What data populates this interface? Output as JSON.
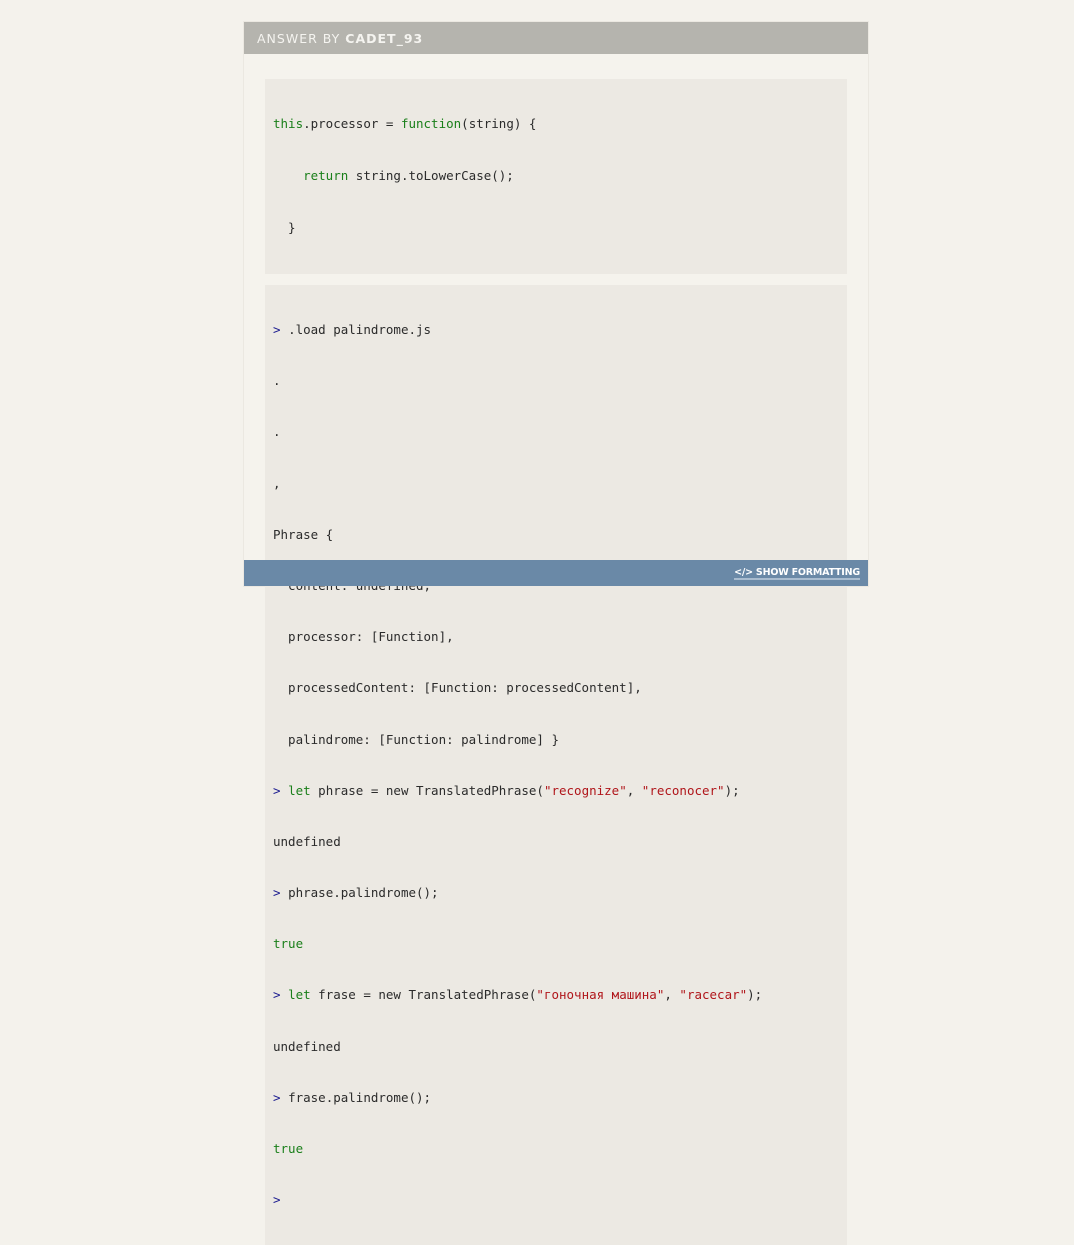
{
  "header": {
    "label": "ANSWER BY",
    "author": "CADET_93"
  },
  "code_block": {
    "lines": [
      {
        "kw1": "this",
        "t1": ".processor = ",
        "kw2": "function",
        "t2": "(string) {"
      },
      {
        "indent": "    ",
        "kw1": "return",
        "t1": " string.toLowerCase();"
      },
      {
        "t1": "  }"
      }
    ]
  },
  "console": {
    "prompt_symbol": ">",
    "lines": {
      "l1": ".load palindrome.js",
      "l2": ".",
      "l3": ".",
      "l4": ",",
      "l5": "Phrase {",
      "l6": "  content: undefined,",
      "l7": "  processor: [Function],",
      "l8": "  processedContent: [Function: processedContent],",
      "l9": "  palindrome: [Function: palindrome] }",
      "l10_kw": "let",
      "l10_a": " phrase = new TranslatedPhrase(",
      "l10_s1": "\"recognize\"",
      "l10_b": ", ",
      "l10_s2": "\"reconocer\"",
      "l10_c": ");",
      "l11": "undefined",
      "l12": "phrase.palindrome();",
      "l13": "true",
      "l14_kw": "let",
      "l14_a": " frase = new TranslatedPhrase(",
      "l14_s1": "\"гоночная машина\"",
      "l14_b": ", ",
      "l14_s2": "\"racecar\"",
      "l14_c": ");",
      "l15": "undefined",
      "l16": "frase.palindrome();",
      "l17": "true"
    }
  },
  "footer": {
    "icon": "</>",
    "show_formatting_label": "SHOW FORMATTING"
  }
}
